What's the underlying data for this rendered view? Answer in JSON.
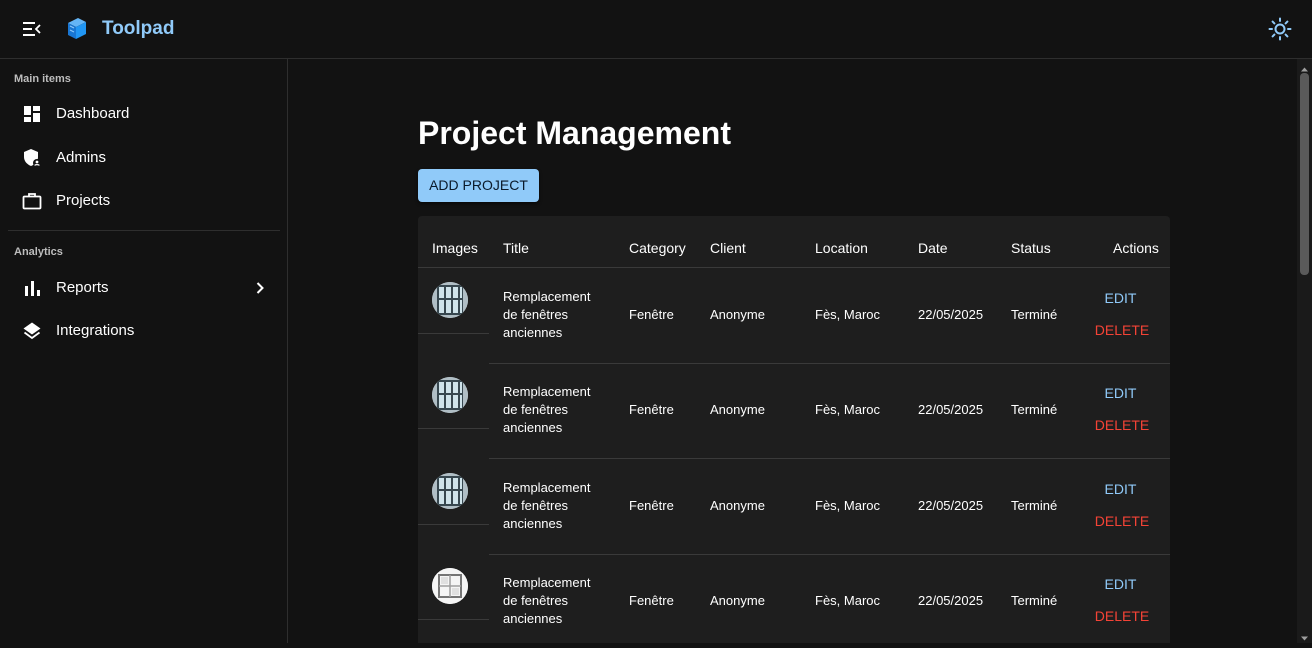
{
  "app": {
    "brand": "Toolpad",
    "accent": "#90caf9",
    "danger": "#f44336"
  },
  "sidebar": {
    "sections": [
      {
        "label": "Main items"
      },
      {
        "label": "Analytics"
      }
    ],
    "items": [
      {
        "label": "Dashboard",
        "icon": "dashboard-icon"
      },
      {
        "label": "Admins",
        "icon": "admin-shield-icon"
      },
      {
        "label": "Projects",
        "icon": "briefcase-icon"
      },
      {
        "label": "Reports",
        "icon": "bar-chart-icon"
      },
      {
        "label": "Integrations",
        "icon": "layers-icon"
      }
    ]
  },
  "main": {
    "title": "Project Management",
    "add_button": "ADD PROJECT",
    "table": {
      "headers": [
        "Images",
        "Title",
        "Category",
        "Client",
        "Location",
        "Date",
        "Status",
        "Actions"
      ],
      "rows": [
        {
          "title": "Remplacement de fenêtres anciennes",
          "category": "Fenêtre",
          "client": "Anonyme",
          "location": "Fès, Maroc",
          "date": "22/05/2025",
          "status": "Terminé",
          "edit": "EDIT",
          "delete": "DELETE"
        },
        {
          "title": "Remplacement de fenêtres anciennes",
          "category": "Fenêtre",
          "client": "Anonyme",
          "location": "Fès, Maroc",
          "date": "22/05/2025",
          "status": "Terminé",
          "edit": "EDIT",
          "delete": "DELETE"
        },
        {
          "title": "Remplacement de fenêtres anciennes",
          "category": "Fenêtre",
          "client": "Anonyme",
          "location": "Fès, Maroc",
          "date": "22/05/2025",
          "status": "Terminé",
          "edit": "EDIT",
          "delete": "DELETE"
        },
        {
          "title": "Remplacement de fenêtres anciennes",
          "category": "Fenêtre",
          "client": "Anonyme",
          "location": "Fès, Maroc",
          "date": "22/05/2025",
          "status": "Terminé",
          "edit": "EDIT",
          "delete": "DELETE"
        }
      ]
    }
  }
}
